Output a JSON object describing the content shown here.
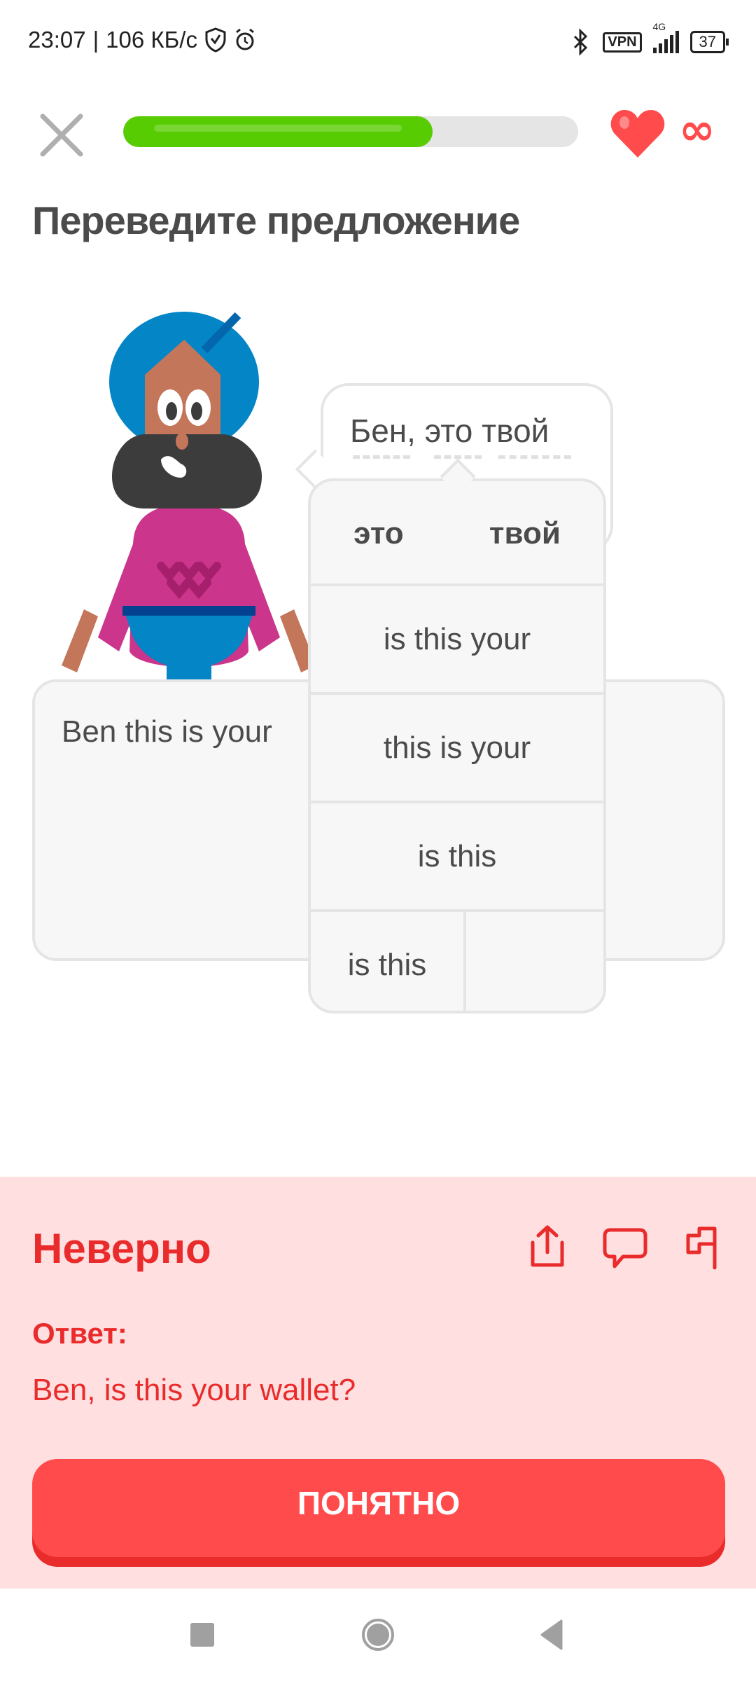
{
  "status_bar": {
    "time": "23:07",
    "speed": "106 КБ/с",
    "vpn": "VPN",
    "network": "4G",
    "battery": "37"
  },
  "header": {
    "progress_percent": 68,
    "hearts": "∞",
    "progress_color": "#58cc02"
  },
  "exercise": {
    "title": "Переведите предложение",
    "prompt": "Бен, это твой",
    "answer_input": "Ben this is your"
  },
  "hint_popup": {
    "headers": [
      "это",
      "твой"
    ],
    "rows": [
      "is this your",
      "this is your",
      "is this"
    ],
    "split_row": [
      "is this",
      ""
    ]
  },
  "feedback": {
    "title": "Неверно",
    "answer_label": "Ответ:",
    "correct_answer": "Ben, is this your wallet?",
    "continue_label": "ПОНЯТНО",
    "color": "#ea2b2b",
    "background": "#ffdfe0"
  }
}
